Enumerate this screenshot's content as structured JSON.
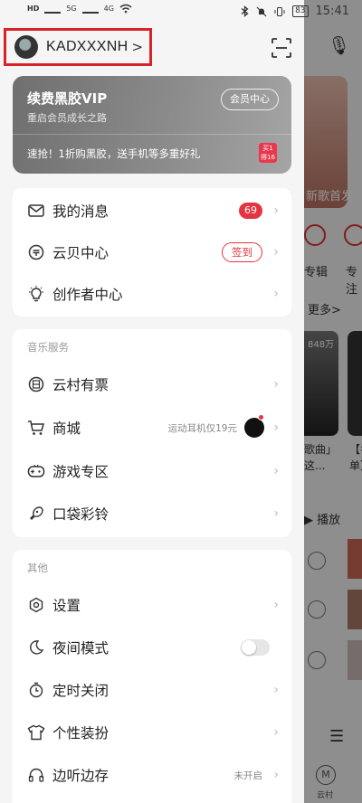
{
  "status_bar": {
    "left_labels": [
      "HD",
      "5G",
      "4G",
      "HD"
    ],
    "battery": "83",
    "time": "15:41"
  },
  "header": {
    "username": "KADXXXNH",
    "chevron": ">"
  },
  "vip": {
    "title": "续费黑胶VIP",
    "subtitle": "重启会员成长之路",
    "center_button": "会员中心",
    "promo": "速抢！1折购黑胶，送手机等多重好礼",
    "badge_line1": "买1",
    "badge_line2": "得16"
  },
  "section_main": {
    "items": [
      {
        "label": "我的消息",
        "badge": "69",
        "icon": "mail-icon"
      },
      {
        "label": "云贝中心",
        "action": "签到",
        "icon": "yunbei-icon"
      },
      {
        "label": "创作者中心",
        "icon": "bulb-icon"
      }
    ]
  },
  "section_music": {
    "title": "音乐服务",
    "items": [
      {
        "label": "云村有票",
        "icon": "ticket-icon"
      },
      {
        "label": "商城",
        "side_text": "运动耳机仅19元",
        "icon": "cart-icon"
      },
      {
        "label": "游戏专区",
        "icon": "gamepad-icon"
      },
      {
        "label": "口袋彩铃",
        "icon": "ringtone-icon"
      }
    ]
  },
  "section_other": {
    "title": "其他",
    "items": [
      {
        "label": "设置",
        "icon": "settings-icon"
      },
      {
        "label": "夜间模式",
        "icon": "moon-icon",
        "toggle": "off"
      },
      {
        "label": "定时关闭",
        "icon": "timer-icon"
      },
      {
        "label": "个性装扮",
        "icon": "shirt-icon"
      },
      {
        "label": "边听边存",
        "side_text": "未开启",
        "icon": "headphones-icon"
      }
    ]
  },
  "background": {
    "banner_text": "新歌首发",
    "cat1": "专辑",
    "cat2": "专注",
    "more": "更多>",
    "play_count": "848万",
    "card_text1": "歌曲」\n这...",
    "card_text2": "【名\n单】",
    "play_all": "▶ 播放",
    "yuncun_label": "云村",
    "yuncun_icon": "M"
  },
  "colors": {
    "accent": "#e3353f",
    "highlight_box": "#d9232a",
    "drawer_bg": "#f5f5f5"
  }
}
